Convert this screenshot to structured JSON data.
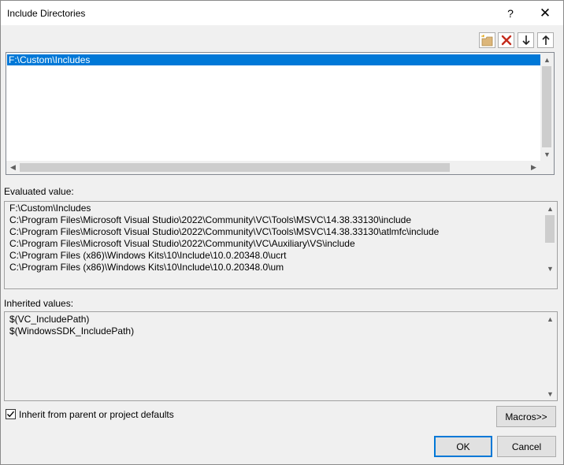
{
  "window": {
    "title": "Include Directories",
    "help": "?",
    "close": "✕"
  },
  "toolbar": {
    "new_line": "new-line",
    "delete": "delete",
    "move_down": "move-down",
    "move_up": "move-up"
  },
  "directories": {
    "items": [
      "F:\\Custom\\Includes"
    ]
  },
  "evaluated": {
    "label": "Evaluated value:",
    "lines": [
      "F:\\Custom\\Includes",
      "C:\\Program Files\\Microsoft Visual Studio\\2022\\Community\\VC\\Tools\\MSVC\\14.38.33130\\include",
      "C:\\Program Files\\Microsoft Visual Studio\\2022\\Community\\VC\\Tools\\MSVC\\14.38.33130\\atlmfc\\include",
      "C:\\Program Files\\Microsoft Visual Studio\\2022\\Community\\VC\\Auxiliary\\VS\\include",
      "C:\\Program Files (x86)\\Windows Kits\\10\\Include\\10.0.20348.0\\ucrt",
      "C:\\Program Files (x86)\\Windows Kits\\10\\Include\\10.0.20348.0\\um"
    ]
  },
  "inherited": {
    "label": "Inherited values:",
    "lines": [
      "$(VC_IncludePath)",
      "$(WindowsSDK_IncludePath)"
    ]
  },
  "inherit_checkbox": {
    "label": "Inherit from parent or project defaults",
    "checked": true
  },
  "buttons": {
    "macros": "Macros>>",
    "ok": "OK",
    "cancel": "Cancel"
  },
  "colors": {
    "selection": "#0078d7",
    "dialog_bg": "#f0f0f0"
  }
}
